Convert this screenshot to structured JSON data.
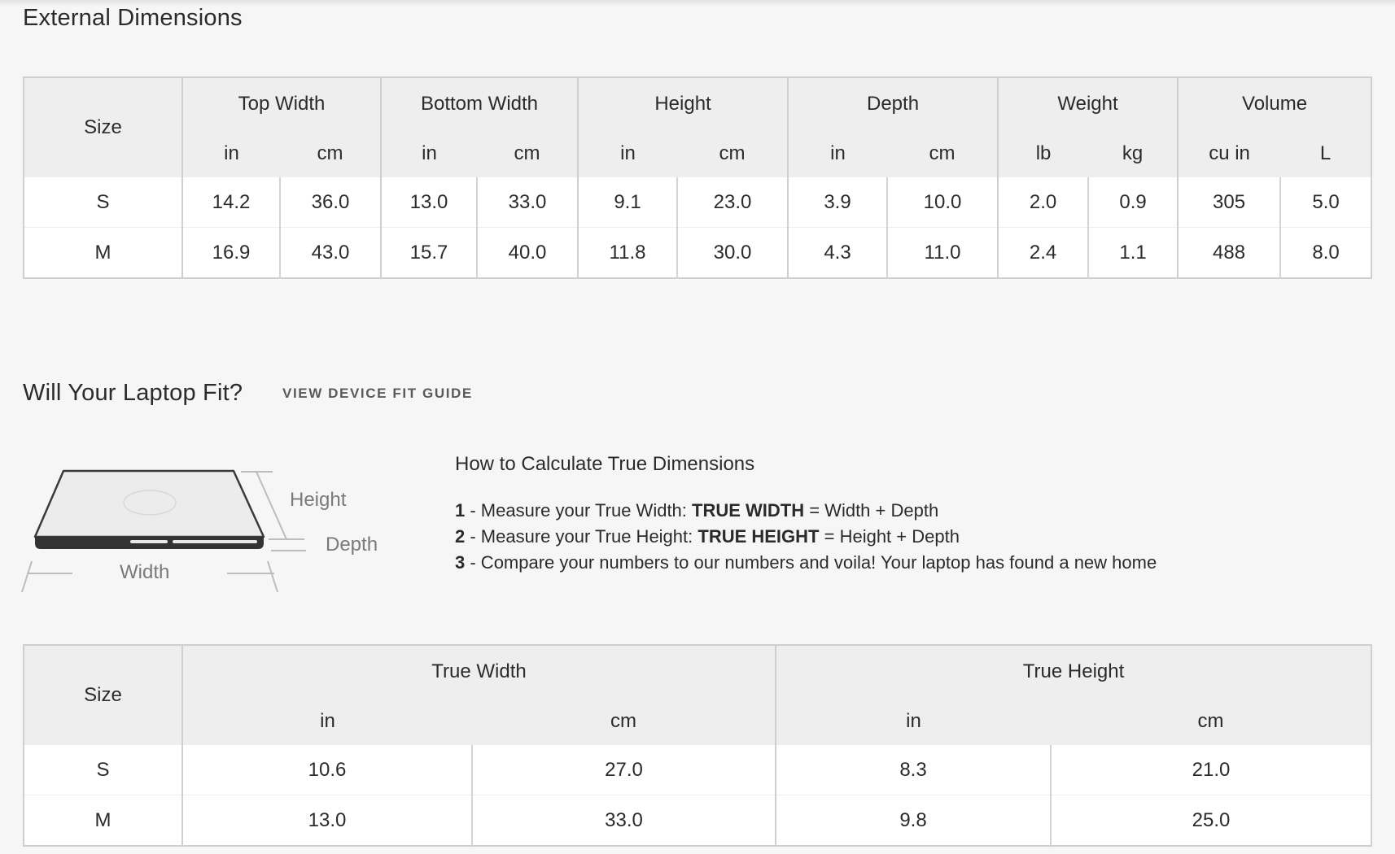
{
  "external": {
    "title": "External Dimensions",
    "size_header": "Size",
    "groups": [
      {
        "label": "Top Width",
        "units": [
          "in",
          "cm"
        ]
      },
      {
        "label": "Bottom Width",
        "units": [
          "in",
          "cm"
        ]
      },
      {
        "label": "Height",
        "units": [
          "in",
          "cm"
        ]
      },
      {
        "label": "Depth",
        "units": [
          "in",
          "cm"
        ]
      },
      {
        "label": "Weight",
        "units": [
          "lb",
          "kg"
        ]
      },
      {
        "label": "Volume",
        "units": [
          "cu in",
          "L"
        ]
      }
    ],
    "rows": [
      {
        "size": "S",
        "values": [
          "14.2",
          "36.0",
          "13.0",
          "33.0",
          "9.1",
          "23.0",
          "3.9",
          "10.0",
          "2.0",
          "0.9",
          "305",
          "5.0"
        ]
      },
      {
        "size": "M",
        "values": [
          "16.9",
          "43.0",
          "15.7",
          "40.0",
          "11.8",
          "30.0",
          "4.3",
          "11.0",
          "2.4",
          "1.1",
          "488",
          "8.0"
        ]
      }
    ]
  },
  "fit": {
    "title": "Will Your Laptop Fit?",
    "link_label": "VIEW DEVICE FIT GUIDE",
    "diagram": {
      "height_label": "Height",
      "depth_label": "Depth",
      "width_label": "Width"
    },
    "how_title": "How to Calculate True Dimensions",
    "steps": [
      {
        "num": "1",
        "pre": " - Measure your True Width: ",
        "bold": "TRUE WIDTH",
        "post": " = Width + Depth"
      },
      {
        "num": "2",
        "pre": " - Measure your True Height: ",
        "bold": "TRUE HEIGHT",
        "post": " = Height + Depth"
      },
      {
        "num": "3",
        "pre": " - Compare your numbers to our numbers and voila! Your laptop has found a new home",
        "bold": "",
        "post": ""
      }
    ]
  },
  "true_dims": {
    "size_header": "Size",
    "groups": [
      {
        "label": "True Width",
        "units": [
          "in",
          "cm"
        ]
      },
      {
        "label": "True Height",
        "units": [
          "in",
          "cm"
        ]
      }
    ],
    "rows": [
      {
        "size": "S",
        "values": [
          "10.6",
          "27.0",
          "8.3",
          "21.0"
        ]
      },
      {
        "size": "M",
        "values": [
          "13.0",
          "33.0",
          "9.8",
          "25.0"
        ]
      }
    ]
  }
}
